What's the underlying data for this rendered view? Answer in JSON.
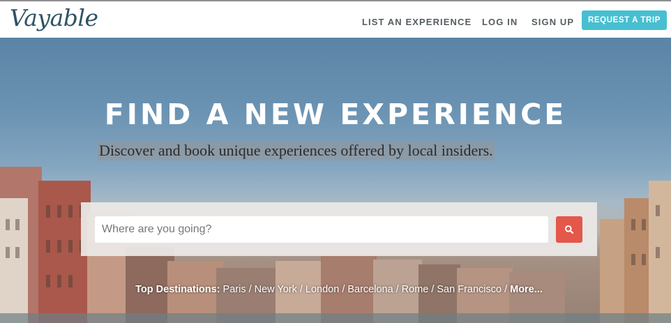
{
  "header": {
    "logo": "Vayable",
    "nav": {
      "list_experience": "LIST AN EXPERIENCE",
      "login": "LOG IN",
      "signup": "SIGN UP",
      "request_trip": "REQUEST A TRIP"
    }
  },
  "hero": {
    "title": "FIND A NEW EXPERIENCE",
    "subtitle": "Discover and book unique experiences offered by local insiders."
  },
  "search": {
    "placeholder": "Where are you going?",
    "button_icon": "search-icon"
  },
  "destinations": {
    "label": "Top Destinations:",
    "items": [
      "Paris",
      "New York",
      "London",
      "Barcelona",
      "Rome",
      "San Francisco"
    ],
    "more": "More...",
    "separator": "/"
  },
  "colors": {
    "brand": "#2f5365",
    "accent_button": "#47bfd1",
    "search_button": "#e4574b"
  }
}
